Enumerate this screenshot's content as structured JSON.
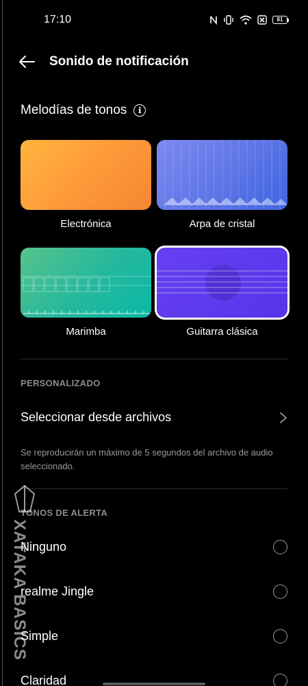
{
  "status_bar": {
    "time": "17:10",
    "battery": "81",
    "icons": [
      "nfc-icon",
      "vibrate-icon",
      "wifi-icon",
      "data-off-icon",
      "battery-icon"
    ]
  },
  "header": {
    "back_icon": "arrow-left-icon",
    "title": "Sonido de notificación"
  },
  "melodies": {
    "title": "Melodías de tonos",
    "info_icon": "info-icon",
    "tiles": [
      {
        "label": "Electrónica",
        "colors": [
          "#ffb53d",
          "#f58633"
        ],
        "selected": false
      },
      {
        "label": "Arpa de cristal",
        "colors": [
          "#7d8af0",
          "#3e66e0"
        ],
        "selected": false
      },
      {
        "label": "Marimba",
        "colors": [
          "#56c38c",
          "#0ab8a6"
        ],
        "selected": false
      },
      {
        "label": "Guitarra clásica",
        "colors": [
          "#6640f2",
          "#5735e8"
        ],
        "selected": true
      }
    ]
  },
  "custom": {
    "section_title": "PERSONALIZADO",
    "select_label": "Seleccionar desde archivos",
    "note": "Se reproducirán un máximo de 5 segundos del archivo de audio seleccionado."
  },
  "alerts": {
    "section_title": "TONOS DE ALERTA",
    "items": [
      {
        "label": "Ninguno",
        "selected": false
      },
      {
        "label": "realme Jingle",
        "selected": false
      },
      {
        "label": "Simple",
        "selected": false
      },
      {
        "label": "Claridad",
        "selected": false
      }
    ]
  },
  "watermark": {
    "text": "XATAKA BASICS"
  }
}
